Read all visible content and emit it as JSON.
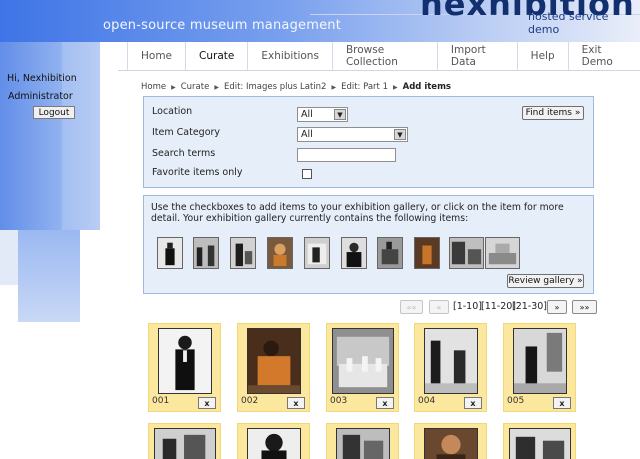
{
  "header": {
    "title": "open-source museum management",
    "logo": "nexhibition",
    "subtitle": "hosted service demo"
  },
  "nav": {
    "items": [
      {
        "label": "Home"
      },
      {
        "label": "Curate"
      },
      {
        "label": "Exhibitions"
      },
      {
        "label": "Browse Collection"
      },
      {
        "label": "Import Data"
      },
      {
        "label": "Help"
      },
      {
        "label": "Exit Demo"
      }
    ],
    "active": "Curate"
  },
  "user": {
    "greeting": "Hi, Nexhibition",
    "role": "Administrator",
    "logout_label": "Logout"
  },
  "breadcrumb": {
    "items": [
      "Home",
      "Curate",
      "Edit: Images plus Latin2",
      "Edit: Part 1",
      "Add items"
    ]
  },
  "search": {
    "location_label": "Location",
    "location_value": "All",
    "category_label": "Item Category",
    "category_value": "All",
    "terms_label": "Search terms",
    "terms_value": "",
    "favorites_label": "Favorite items only",
    "find_label": "Find items »"
  },
  "gallery": {
    "instructions": "Use the checkboxes to add items to your exhibition gallery, or click on the item for more detail. Your exhibition gallery currently contains the following items:",
    "review_label": "Review gallery »"
  },
  "pager": {
    "first_label": "««",
    "prev_label": "«",
    "range_current": "[1-10]",
    "range_2": "[11-20]",
    "range_3": "[21-30]",
    "next_label": "»",
    "last_label": "»»"
  },
  "items": [
    {
      "number": "001",
      "remove": "x"
    },
    {
      "number": "002",
      "remove": "x"
    },
    {
      "number": "003",
      "remove": "x"
    },
    {
      "number": "004",
      "remove": "x"
    },
    {
      "number": "005",
      "remove": "x"
    }
  ]
}
